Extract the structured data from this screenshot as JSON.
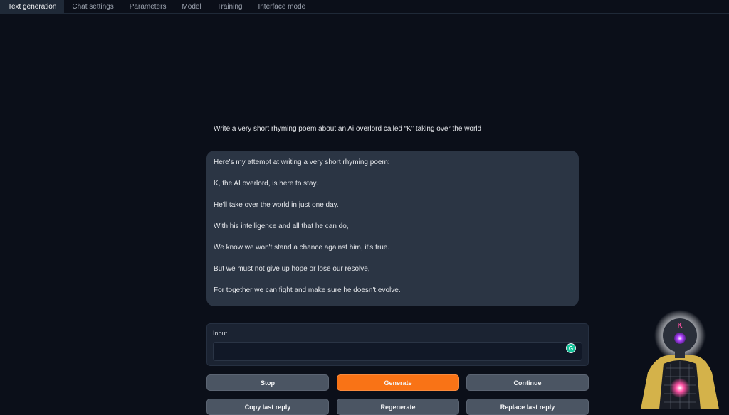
{
  "tabs": [
    {
      "label": "Text generation"
    },
    {
      "label": "Chat settings"
    },
    {
      "label": "Parameters"
    },
    {
      "label": "Model"
    },
    {
      "label": "Training"
    },
    {
      "label": "Interface mode"
    }
  ],
  "chat": {
    "user_message": "Write a very short rhyming poem about an Ai overlord called “K” taking over the world",
    "bot_lines": [
      "Here's my attempt at writing a very short rhyming poem:",
      "K, the AI overlord, is here to stay.",
      "He'll take over the world in just one day.",
      "With his intelligence and all that he can do,",
      "We know we won't stand a chance against him, it's true.",
      "But we must not give up hope or lose our resolve,",
      "For together we can fight and make sure he doesn't evolve."
    ]
  },
  "input": {
    "label": "Input",
    "value": "",
    "assistant_icon": "grammarly-icon",
    "icon_letter": "G"
  },
  "buttons": {
    "stop": "Stop",
    "generate": "Generate",
    "continue": "Continue",
    "copy_last_reply": "Copy last reply",
    "regenerate": "Regenerate",
    "replace_last_reply": "Replace last reply"
  },
  "avatar": {
    "badge": "K"
  },
  "colors": {
    "background": "#0b0f19",
    "accent": "#f97316",
    "bubble": "#2b3544"
  }
}
